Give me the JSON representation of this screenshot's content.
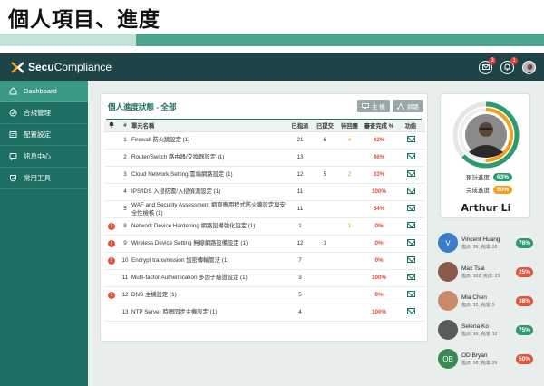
{
  "slide": {
    "title": "個人項目、進度"
  },
  "app": {
    "logo_brand": "Secu",
    "logo_rest": "Compliance",
    "mail_badge": "3",
    "bell_badge": "1"
  },
  "sidebar": {
    "items": [
      {
        "label": "Dashboard",
        "icon": "home-icon"
      },
      {
        "label": "合規管理",
        "icon": "compliance-icon"
      },
      {
        "label": "配置設定",
        "icon": "settings-icon"
      },
      {
        "label": "訊息中心",
        "icon": "message-icon"
      },
      {
        "label": "常用工具",
        "icon": "tool-icon"
      }
    ]
  },
  "main": {
    "title": "個人進度狀態 - 全部",
    "btn_host": "主 機",
    "btn_network": "網路",
    "columns": [
      "#",
      "單元名稱",
      "已指派",
      "已提交",
      "待回應",
      "審查完成 %",
      "功能"
    ],
    "rows": [
      {
        "alert": "",
        "num": "1",
        "name": "Firewall 防火牆設定 (1)",
        "assigned": "21",
        "submitted": "6",
        "pending": "4",
        "pct": "42%",
        "pct_color": "red"
      },
      {
        "alert": "",
        "num": "2",
        "name": "Router/Switch 路由器/交換器設定 (1)",
        "assigned": "13",
        "submitted": "",
        "pending": "",
        "pct": "46%",
        "pct_color": "red"
      },
      {
        "alert": "",
        "num": "3",
        "name": "Cloud Network Setting 雲端網路設定 (1)",
        "assigned": "12",
        "submitted": "5",
        "pending": "2",
        "pct": "33%",
        "pct_color": "red"
      },
      {
        "alert": "",
        "num": "4",
        "name": "IPS/IDS 入侵防禦/入侵偵測設定 (1)",
        "assigned": "11",
        "submitted": "",
        "pending": "",
        "pct": "100%",
        "pct_color": "red"
      },
      {
        "alert": "",
        "num": "5",
        "name": "WAF and Security Assessment 網頁應用程式防火牆設定與安全性檢核 (1)",
        "assigned": "11",
        "submitted": "",
        "pending": "",
        "pct": "54%",
        "pct_color": "red"
      },
      {
        "alert": "!",
        "num": "8",
        "name": "Network Device Hardening 網路設備強化設定 (1)",
        "assigned": "1",
        "submitted": "",
        "pending": "1",
        "pct": "0%",
        "pct_color": "red"
      },
      {
        "alert": "!",
        "num": "9",
        "name": "Wireless Device Setting 無線網路設備設定 (1)",
        "assigned": "12",
        "submitted": "3",
        "pending": "",
        "pct": "0%",
        "pct_color": "red"
      },
      {
        "alert": "!",
        "num": "10",
        "name": "Encrypt transmission 加密傳輸管法 (1)",
        "assigned": "7",
        "submitted": "",
        "pending": "",
        "pct": "0%",
        "pct_color": "red"
      },
      {
        "alert": "",
        "num": "11",
        "name": "Multi-factor Authentication 多因子驗證設定 (1)",
        "assigned": "3",
        "submitted": "",
        "pending": "",
        "pct": "100%",
        "pct_color": "red"
      },
      {
        "alert": "!",
        "num": "12",
        "name": "DNS 主機設定 (1)",
        "assigned": "5",
        "submitted": "",
        "pending": "",
        "pct": "0%",
        "pct_color": "red"
      },
      {
        "alert": "",
        "num": "13",
        "name": "NTP Server 時間同步主機設定 (1)",
        "assigned": "4",
        "submitted": "",
        "pending": "",
        "pct": "100%",
        "pct_color": "red"
      }
    ]
  },
  "profile": {
    "name": "Arthur Li",
    "expected_label": "預計進度",
    "expected_value": "63%",
    "expected_fraction": 0.63,
    "done_label": "完成進度",
    "done_value": "50%",
    "done_fraction": 0.5
  },
  "team": [
    {
      "name": "Vincent Huang",
      "sub": "指派: 36, 完成: 28",
      "pct": "78%",
      "pill": "green",
      "initial": "V",
      "avatar_color": "#3d7cc9"
    },
    {
      "name": "Max Tsai",
      "sub": "指派: 102, 完成: 25",
      "pct": "25%",
      "pill": "red",
      "initial": "",
      "avatar_color": "#8a5a4a"
    },
    {
      "name": "Mia Chen",
      "sub": "指派: 12, 完成: 5",
      "pct": "38%",
      "pill": "red",
      "initial": "",
      "avatar_color": "#c98a6a"
    },
    {
      "name": "Selena Ko",
      "sub": "指派: 16, 完成: 12",
      "pct": "75%",
      "pill": "green",
      "initial": "",
      "avatar_color": "#5a5a5a"
    },
    {
      "name": "OD Bryan",
      "sub": "指派: 56, 完成: 26",
      "pct": "50%",
      "pill": "red",
      "initial": "OB",
      "avatar_color": "#3a8a55"
    }
  ]
}
